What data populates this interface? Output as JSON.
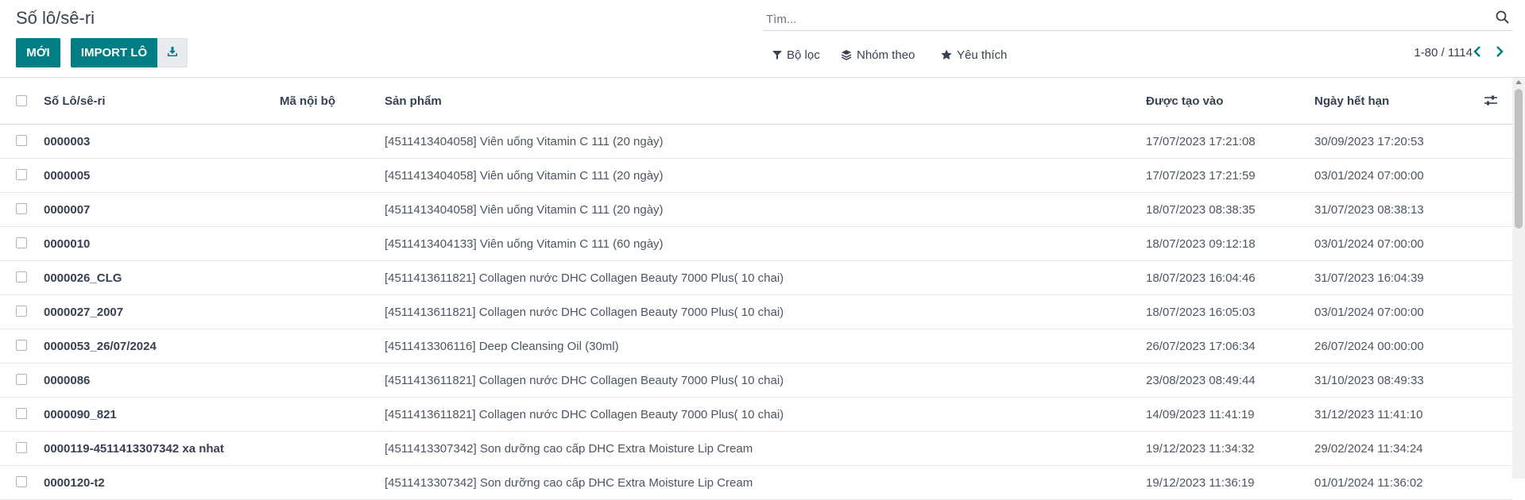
{
  "header": {
    "title": "Số lô/sê-ri",
    "new_label": "MỚI",
    "import_label": "IMPORT LÔ",
    "download_icon": "download-icon"
  },
  "search": {
    "placeholder": "Tìm...",
    "icon": "search-icon"
  },
  "filters": {
    "filter_label": "Bộ lọc",
    "group_label": "Nhóm theo",
    "favorite_label": "Yêu thích"
  },
  "pager": {
    "value": "1-80 / 1114"
  },
  "columns": {
    "lot": "Số Lô/sê-ri",
    "ref": "Mã nội bộ",
    "product": "Sản phẩm",
    "created": "Được tạo vào",
    "expiry": "Ngày hết hạn"
  },
  "rows": [
    {
      "lot": "0000003",
      "ref": "",
      "product": "[4511413404058] Viên uống Vitamin C 111 (20 ngày)",
      "created": "17/07/2023 17:21:08",
      "expiry": "30/09/2023 17:20:53"
    },
    {
      "lot": "0000005",
      "ref": "",
      "product": "[4511413404058] Viên uống Vitamin C 111 (20 ngày)",
      "created": "17/07/2023 17:21:59",
      "expiry": "03/01/2024 07:00:00"
    },
    {
      "lot": "0000007",
      "ref": "",
      "product": "[4511413404058] Viên uống Vitamin C 111 (20 ngày)",
      "created": "18/07/2023 08:38:35",
      "expiry": "31/07/2023 08:38:13"
    },
    {
      "lot": "0000010",
      "ref": "",
      "product": "[4511413404133] Viên uống Vitamin C 111 (60 ngày)",
      "created": "18/07/2023 09:12:18",
      "expiry": "03/01/2024 07:00:00"
    },
    {
      "lot": "0000026_CLG",
      "ref": "",
      "product": "[4511413611821] Collagen nước DHC Collagen Beauty 7000 Plus( 10 chai)",
      "created": "18/07/2023 16:04:46",
      "expiry": "31/07/2023 16:04:39"
    },
    {
      "lot": "0000027_2007",
      "ref": "",
      "product": "[4511413611821] Collagen nước DHC Collagen Beauty 7000 Plus( 10 chai)",
      "created": "18/07/2023 16:05:03",
      "expiry": "03/01/2024 07:00:00"
    },
    {
      "lot": "0000053_26/07/2024",
      "ref": "",
      "product": "[4511413306116] Deep Cleansing Oil (30ml)",
      "created": "26/07/2023 17:06:34",
      "expiry": "26/07/2024 00:00:00"
    },
    {
      "lot": "0000086",
      "ref": "",
      "product": "[4511413611821] Collagen nước DHC Collagen Beauty 7000 Plus( 10 chai)",
      "created": "23/08/2023 08:49:44",
      "expiry": "31/10/2023 08:49:33"
    },
    {
      "lot": "0000090_821",
      "ref": "",
      "product": "[4511413611821] Collagen nước DHC Collagen Beauty 7000 Plus( 10 chai)",
      "created": "14/09/2023 11:41:19",
      "expiry": "31/12/2023 11:41:10"
    },
    {
      "lot": "0000119-4511413307342 xa nhat",
      "ref": "",
      "product": "[4511413307342] Son dưỡng cao cấp DHC Extra Moisture Lip Cream",
      "created": "19/12/2023 11:34:32",
      "expiry": "29/02/2024 11:34:24"
    },
    {
      "lot": "0000120-t2",
      "ref": "",
      "product": "[4511413307342] Son dưỡng cao cấp DHC Extra Moisture Lip Cream",
      "created": "19/12/2023 11:36:19",
      "expiry": "01/01/2024 11:36:02"
    }
  ],
  "colors": {
    "primary": "#017e84",
    "text": "#374151",
    "border": "#d8dadd"
  }
}
